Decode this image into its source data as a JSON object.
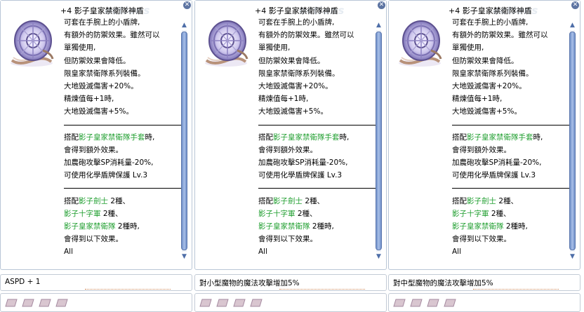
{
  "panels": [
    {
      "title": "+4 影子皇家禁衛隊神盾",
      "watermark": "ections",
      "bonus_text": "ASPD + 1",
      "desc": [
        {
          "t": "可套在手腕上的小盾牌,"
        },
        {
          "t": "有額外的防禦效果。雖然可以"
        },
        {
          "t": "單獨使用,"
        },
        {
          "t": "但防禦效果會降低。"
        },
        {
          "t": "限皇家禁衛隊系列裝備。"
        },
        {
          "t": "大地毀滅傷害+20%。"
        },
        {
          "t": "精煉值每+1時,"
        },
        {
          "t": "大地毀滅傷害+5%。"
        }
      ]
    },
    {
      "title": "+4 影子皇家禁衛隊神盾",
      "watermark": "ections",
      "bonus_text": "對小型魔物的魔法攻擊增加5%"
    },
    {
      "title": "+4 影子皇家禁衛隊神盾",
      "watermark": "ections",
      "bonus_text": "對中型魔物的魔法攻擊增加5%"
    }
  ],
  "desc_lines": {
    "l1": "可套在手腕上的小盾牌,",
    "l2": "有額外的防禦效果。雖然可以",
    "l3": "單獨使用,",
    "l4": "但防禦效果會降低。",
    "l5": "限皇家禁衛隊系列裝備。",
    "l6": "大地毀滅傷害+20%。",
    "l7": "精煉值每+1時,",
    "l8": "大地毀滅傷害+5%。",
    "c1_pre": "搭配",
    "c1_green": "影子皇家禁衛隊手套",
    "c1_post": "時,",
    "c2": "會得到額外效果。",
    "c3": "加農砲攻擊SP消耗量-20%,",
    "c4": "可使用化學盾牌保護 Lv.3",
    "d1_pre": "搭配",
    "d1_green": "影子劍士",
    "d1_post": " 2種、",
    "d2_green": "影子十字軍",
    "d2_post": " 2種、",
    "d3_green": "影子皇家禁衛隊",
    "d3_post": " 2種時,",
    "d4": "會得到以下效果。",
    "d5": "All"
  },
  "icons": {
    "close": "close-icon",
    "scroll_up": "arrow-up-icon",
    "scroll_down": "arrow-down-icon",
    "item": "shield-item-icon",
    "card_slot": "card-slot-icon"
  },
  "colors": {
    "green_text": "#1e9e2e",
    "scroll_thumb": "#7f9fd6",
    "border": "#b9c6d6"
  }
}
